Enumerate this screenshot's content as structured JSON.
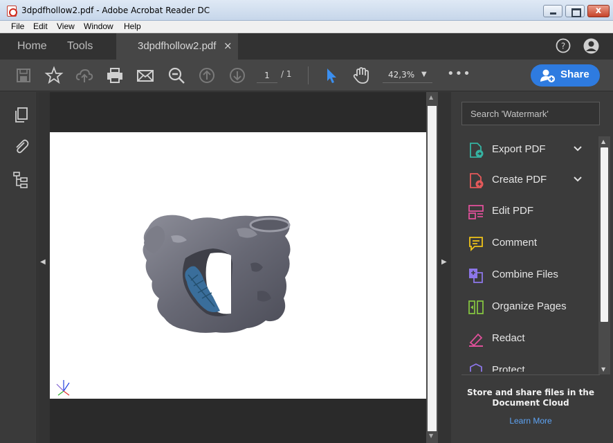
{
  "window": {
    "title": "3dpdfhollow2.pdf - Adobe Acrobat Reader DC",
    "close_glyph": "x"
  },
  "menu": [
    "File",
    "Edit",
    "View",
    "Window",
    "Help"
  ],
  "tabs": {
    "home": "Home",
    "tools": "Tools",
    "document": "3dpdfhollow2.pdf",
    "close_glyph": "×"
  },
  "toolbar": {
    "page_current": "1",
    "page_total": "/ 1",
    "zoom": "42,3%",
    "more": "•••",
    "share_label": "Share"
  },
  "panel": {
    "search_placeholder": "Search 'Watermark'",
    "tools": [
      {
        "label": "Export PDF",
        "icon": "export-pdf-icon",
        "color": "#35b3a2",
        "expandable": true
      },
      {
        "label": "Create PDF",
        "icon": "create-pdf-icon",
        "color": "#e5595a",
        "expandable": true
      },
      {
        "label": "Edit PDF",
        "icon": "edit-pdf-icon",
        "color": "#e0509a",
        "expandable": false
      },
      {
        "label": "Comment",
        "icon": "comment-icon",
        "color": "#f0c419",
        "expandable": false
      },
      {
        "label": "Combine Files",
        "icon": "combine-files-icon",
        "color": "#8c76e8",
        "expandable": false
      },
      {
        "label": "Organize Pages",
        "icon": "organize-pages-icon",
        "color": "#84c341",
        "expandable": false
      },
      {
        "label": "Redact",
        "icon": "redact-icon",
        "color": "#e0509a",
        "expandable": false
      },
      {
        "label": "Protect",
        "icon": "protect-icon",
        "color": "#8c76e8",
        "expandable": false
      }
    ],
    "cloud_text": "Store and share files in the Document Cloud",
    "learn_more": "Learn More"
  },
  "colors": {
    "accent": "#2e7be0",
    "link": "#5ea4f5",
    "model_body": "#6e6f7a",
    "model_inner": "#3a6e9b"
  }
}
